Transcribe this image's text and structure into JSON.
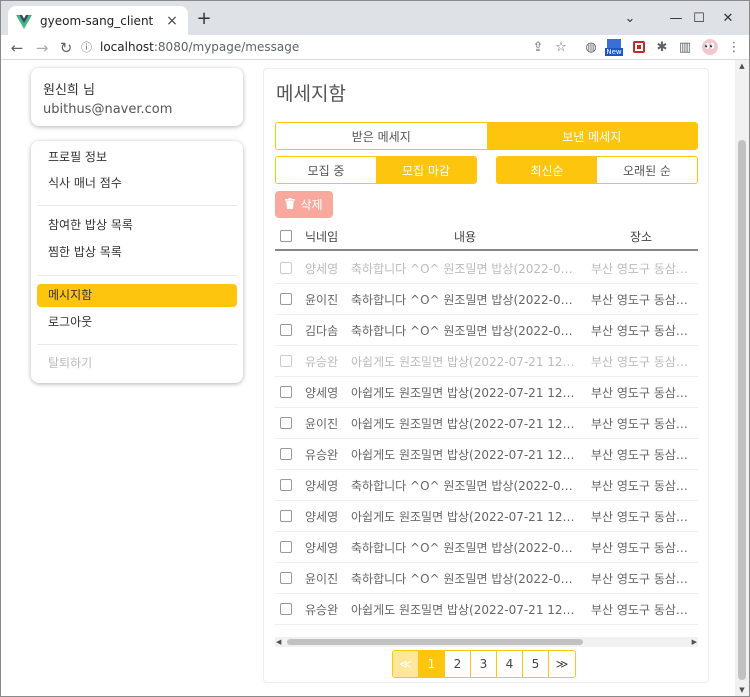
{
  "browser": {
    "tab_title": "gyeom-sang_client",
    "new_badge": "New",
    "url_host": "localhost",
    "url_rest": ":8080/mypage/message"
  },
  "profile": {
    "name": "원신희 님",
    "email": "ubithus@naver.com"
  },
  "menu": {
    "profile_info": "프로필 정보",
    "manners": "식사 매너 점수",
    "joined": "참여한 밥상 목록",
    "liked": "찜한 밥상 목록",
    "messages": "메시지함",
    "logout": "로그아웃",
    "withdraw": "탈퇴하기"
  },
  "main": {
    "title": "메세지함",
    "tabs": {
      "received": "받은 메세지",
      "sent": "보낸 메세지"
    },
    "filter_status": {
      "recruiting": "모집 중",
      "closed": "모집 마감"
    },
    "filter_sort": {
      "newest": "최신순",
      "oldest": "오래된 순"
    },
    "delete_label": "삭제",
    "columns": {
      "nickname": "닉네임",
      "content": "내용",
      "place": "장소"
    },
    "rows": [
      {
        "nickname": "양세영",
        "content": "축하합니다 ^O^ 원조밀면 밥상(2022-0…",
        "place": "부산 영도구 동삼…",
        "read": true
      },
      {
        "nickname": "윤이진",
        "content": "축하합니다 ^O^ 원조밀면 밥상(2022-0…",
        "place": "부산 영도구 동삼…",
        "read": false
      },
      {
        "nickname": "김다솜",
        "content": "축하합니다 ^O^ 원조밀면 밥상(2022-0…",
        "place": "부산 영도구 동삼…",
        "read": false
      },
      {
        "nickname": "유승완",
        "content": "아쉽게도 원조밀면 밥상(2022-07-21 12…",
        "place": "부산 영도구 동삼…",
        "read": true
      },
      {
        "nickname": "양세영",
        "content": "아쉽게도 원조밀면 밥상(2022-07-21 12…",
        "place": "부산 영도구 동삼…",
        "read": false
      },
      {
        "nickname": "윤이진",
        "content": "아쉽게도 원조밀면 밥상(2022-07-21 12…",
        "place": "부산 영도구 동삼…",
        "read": false
      },
      {
        "nickname": "유승완",
        "content": "아쉽게도 원조밀면 밥상(2022-07-21 12…",
        "place": "부산 영도구 동삼…",
        "read": false
      },
      {
        "nickname": "양세영",
        "content": "축하합니다 ^O^ 원조밀면 밥상(2022-0…",
        "place": "부산 영도구 동삼…",
        "read": false
      },
      {
        "nickname": "양세영",
        "content": "아쉽게도 원조밀면 밥상(2022-07-21 12…",
        "place": "부산 영도구 동삼…",
        "read": false
      },
      {
        "nickname": "양세영",
        "content": "축하합니다 ^O^ 원조밀면 밥상(2022-0…",
        "place": "부산 영도구 동삼…",
        "read": false
      },
      {
        "nickname": "윤이진",
        "content": "축하합니다 ^O^ 원조밀면 밥상(2022-0…",
        "place": "부산 영도구 동삼…",
        "read": false
      },
      {
        "nickname": "유승완",
        "content": "아쉽게도 원조밀면 밥상(2022-07-21 12…",
        "place": "부산 영도구 동삼…",
        "read": false
      }
    ],
    "pagination": {
      "first": "≪",
      "pages": [
        "1",
        "2",
        "3",
        "4",
        "5"
      ],
      "last": "≫",
      "current": "1"
    }
  },
  "colors": {
    "accent": "#fec50f",
    "delete": "#f8a89c"
  }
}
